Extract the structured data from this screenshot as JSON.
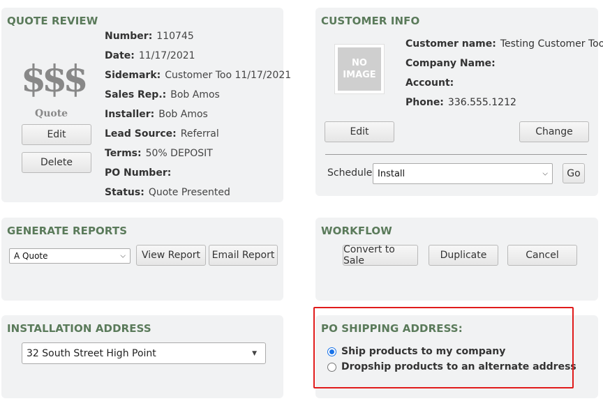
{
  "quote_review": {
    "title": "QUOTE REVIEW",
    "icon_text": "$$$",
    "icon_label": "Quote",
    "edit_label": "Edit",
    "delete_label": "Delete",
    "fields": [
      {
        "key": "Number:",
        "value": "110745"
      },
      {
        "key": "Date:",
        "value": "11/17/2021"
      },
      {
        "key": "Sidemark:",
        "value": "Customer Too 11/17/2021"
      },
      {
        "key": "Sales Rep.:",
        "value": "Bob Amos"
      },
      {
        "key": "Installer:",
        "value": "Bob Amos"
      },
      {
        "key": "Lead Source:",
        "value": "Referral"
      },
      {
        "key": "Terms:",
        "value": "50% DEPOSIT"
      },
      {
        "key": "PO Number:",
        "value": ""
      },
      {
        "key": "Status:",
        "value": "Quote Presented"
      }
    ]
  },
  "customer_info": {
    "title": "CUSTOMER INFO",
    "no_image_text": "NO IMAGE",
    "fields": [
      {
        "key": "Customer name:",
        "value": "Testing Customer Too"
      },
      {
        "key": "Company Name:",
        "value": ""
      },
      {
        "key": "Account:",
        "value": ""
      },
      {
        "key": "Phone:",
        "value": "336.555.1212"
      }
    ],
    "edit_label": "Edit",
    "change_label": "Change",
    "schedule_label": "Schedule:",
    "schedule_value": "Install",
    "go_label": "Go"
  },
  "generate_reports": {
    "title": "GENERATE REPORTS",
    "report_value": "A Quote",
    "view_label": "View Report",
    "email_label": "Email Report"
  },
  "workflow": {
    "title": "WORKFLOW",
    "convert_label": "Convert to Sale",
    "duplicate_label": "Duplicate",
    "cancel_label": "Cancel"
  },
  "installation_address": {
    "title": "INSTALLATION ADDRESS",
    "value": "32 South Street High Point"
  },
  "po_shipping": {
    "title": "PO SHIPPING ADDRESS:",
    "options": [
      {
        "label": "Ship products to my company",
        "selected": true
      },
      {
        "label": "Dropship products to an alternate address",
        "selected": false
      }
    ]
  },
  "colors": {
    "title_green": "#5a7a5a",
    "panel_bg": "#f1f2f3",
    "highlight_red": "#e01b1b",
    "radio_blue": "#1a73e8"
  }
}
